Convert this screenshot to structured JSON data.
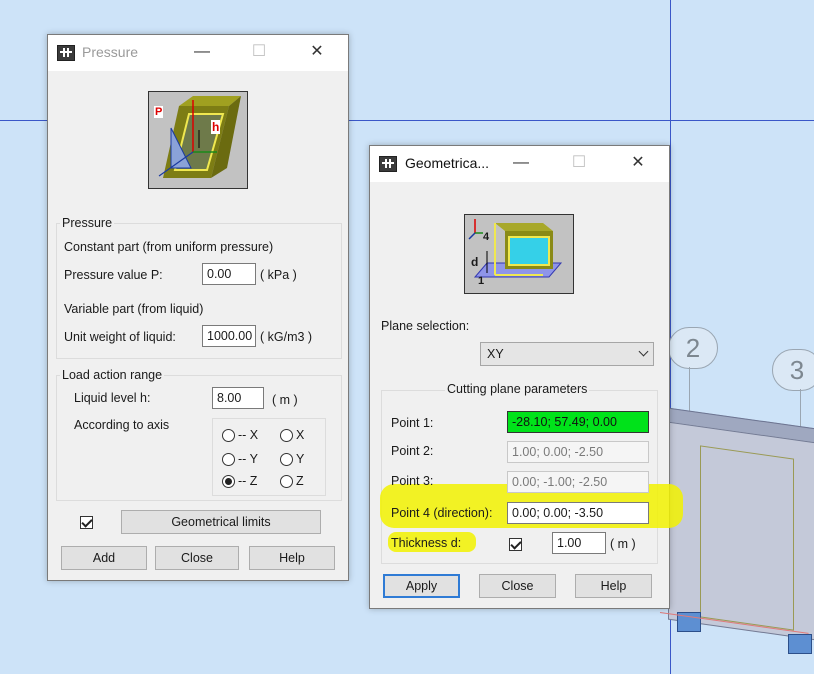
{
  "background": {
    "axis_labels": [
      "2",
      "3"
    ]
  },
  "pressure_dialog": {
    "title": "Pressure",
    "pressure_group": {
      "label": "Pressure",
      "constant_label": "Constant part (from uniform pressure)",
      "pressure_value_label": "Pressure value P:",
      "pressure_value": "0.00",
      "pressure_unit": "( kPa )",
      "variable_label": "Variable part (from liquid)",
      "unit_weight_label": "Unit weight of liquid:",
      "unit_weight_value": "1000.00",
      "unit_weight_unit": "( kG/m3 )"
    },
    "range_group": {
      "label": "Load action range",
      "liquid_level_label": "Liquid level h:",
      "liquid_level_value": "8.00",
      "liquid_level_unit": "( m )",
      "axis_label": "According to axis",
      "radios": [
        {
          "label": "-- X",
          "checked": false
        },
        {
          "label": "X",
          "checked": false
        },
        {
          "label": "-- Y",
          "checked": false
        },
        {
          "label": "Y",
          "checked": false
        },
        {
          "label": "-- Z",
          "checked": true
        },
        {
          "label": "Z",
          "checked": false
        }
      ]
    },
    "geometrical_limits_checked": true,
    "geometrical_limits_button": "Geometrical limits",
    "buttons": {
      "add": "Add",
      "close": "Close",
      "help": "Help"
    },
    "diagram_labels": {
      "p": "P",
      "h": "h"
    }
  },
  "geometry_dialog": {
    "title": "Geometrica...",
    "plane_selection_label": "Plane selection:",
    "plane_selection_value": "XY",
    "group_label": "Cutting plane parameters",
    "point1_label": "Point 1:",
    "point1_value": "-28.10; 57.49; 0.00",
    "point2_label": "Point 2:",
    "point2_value": "1.00; 0.00; -2.50",
    "point3_label": "Point 3:",
    "point3_value": "0.00; -1.00; -2.50",
    "point4_label": "Point 4 (direction):",
    "point4_value": "0.00; 0.00; -3.50",
    "thickness_label": "Thickness d:",
    "thickness_checked": true,
    "thickness_value": "1.00",
    "thickness_unit": "( m )",
    "buttons": {
      "apply": "Apply",
      "close": "Close",
      "help": "Help"
    },
    "diagram_labels": {
      "four": "4",
      "d": "d",
      "one": "1"
    }
  }
}
